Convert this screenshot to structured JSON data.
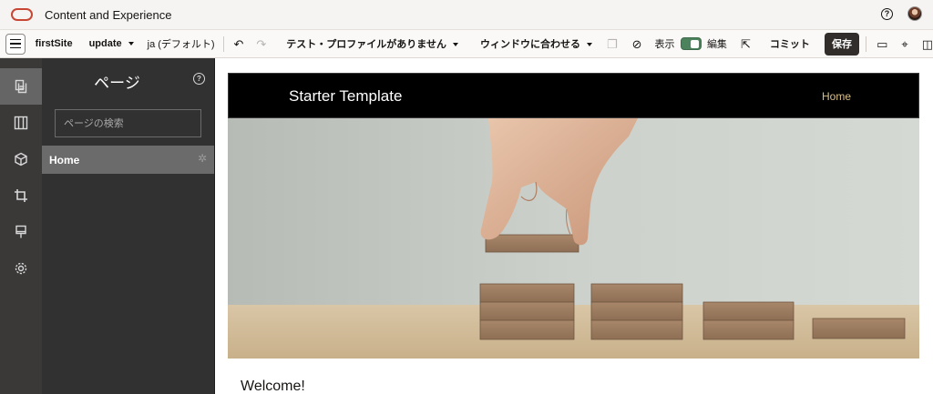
{
  "app": {
    "title": "Content and Experience"
  },
  "toolbar": {
    "site_name": "firstSite",
    "update": "update",
    "language": "ja (デフォルト)",
    "test_profile": "テスト・プロファイルがありません",
    "fit_window": "ウィンドウに合わせる",
    "view_label": "表示",
    "edit_label": "編集",
    "commit_label": "コミット",
    "save_label": "保存"
  },
  "panel": {
    "title": "ページ",
    "search_placeholder": "ページの検索",
    "pages": [
      {
        "label": "Home"
      }
    ]
  },
  "site": {
    "brand": "Starter Template",
    "nav_link": "Home",
    "welcome": "Welcome!"
  },
  "colors": {
    "oracle_red": "#c74634",
    "toggle_green": "#4c825c",
    "save_button": "#312d2a",
    "rail_bg": "#3a3938",
    "panel_bg": "#313131",
    "selected_row": "#6b6b6b",
    "nav_link_gold": "#d9c089"
  },
  "icons": {
    "rail": [
      "pages-icon",
      "components-icon",
      "themes-cube-icon",
      "crop-icon",
      "paint-brush-icon",
      "settings-gear-icon"
    ]
  }
}
